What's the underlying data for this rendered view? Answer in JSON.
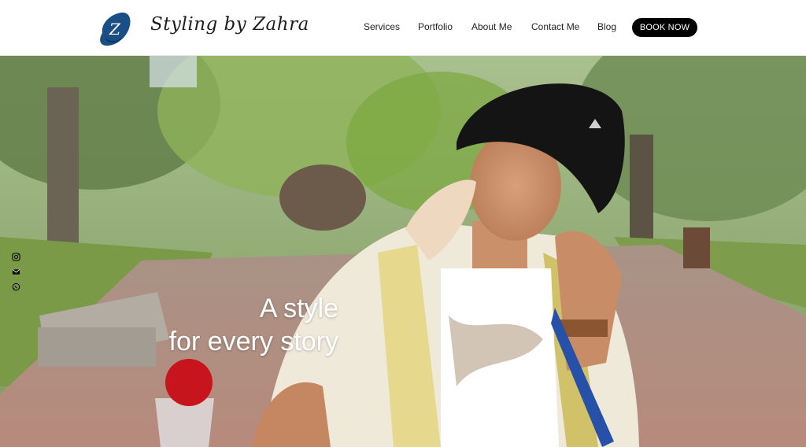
{
  "header": {
    "brand": "Styling by Zahra",
    "logo_letter": "Z",
    "nav": [
      {
        "label": "Services"
      },
      {
        "label": "Portfolio"
      },
      {
        "label": "About Me"
      },
      {
        "label": "Contact Me"
      },
      {
        "label": "Blog"
      }
    ],
    "cta_label": "BOOK NOW"
  },
  "hero": {
    "headline_line1": "A style",
    "headline_line2": "for every story",
    "social_icons": [
      "instagram-icon",
      "email-icon",
      "whatsapp-icon"
    ]
  },
  "colors": {
    "logo_blue": "#1a4f86",
    "cta_bg": "#000000",
    "text_dark": "#222222"
  }
}
